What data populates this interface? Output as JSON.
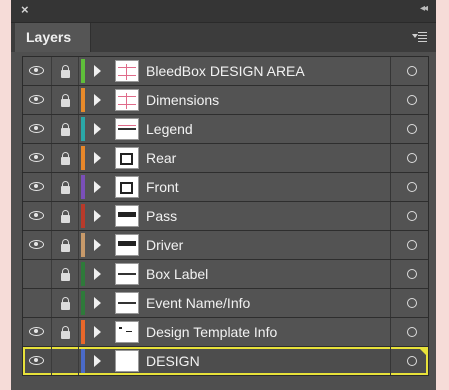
{
  "panel": {
    "close_glyph": "×",
    "collapse_glyph": "◂◂",
    "tab_label": "Layers",
    "menu_icon": "panel-menu-icon"
  },
  "layers": [
    {
      "name": "BleedBox DESIGN AREA",
      "visible": true,
      "locked": true,
      "color": "#5fbf3a",
      "thumb": "guides"
    },
    {
      "name": "Dimensions",
      "visible": true,
      "locked": true,
      "color": "#e88a2a",
      "thumb": "guides"
    },
    {
      "name": "Legend",
      "visible": true,
      "locked": true,
      "color": "#2aa8a8",
      "thumb": "legend"
    },
    {
      "name": "Rear",
      "visible": true,
      "locked": true,
      "color": "#e8872a",
      "thumb": "box"
    },
    {
      "name": "Front",
      "visible": true,
      "locked": true,
      "color": "#7a4fb8",
      "thumb": "box"
    },
    {
      "name": "Pass",
      "visible": true,
      "locked": true,
      "color": "#b83a2a",
      "thumb": "bar"
    },
    {
      "name": "Driver",
      "visible": true,
      "locked": true,
      "color": "#c89a6a",
      "thumb": "bar"
    },
    {
      "name": "Box Label",
      "visible": false,
      "locked": true,
      "color": "#2e7a3a",
      "thumb": "line"
    },
    {
      "name": "Event Name/Info",
      "visible": false,
      "locked": true,
      "color": "#2e7a3a",
      "thumb": "line"
    },
    {
      "name": "Design Template Info",
      "visible": true,
      "locked": true,
      "color": "#e8672a",
      "thumb": "dots"
    },
    {
      "name": "DESIGN",
      "visible": true,
      "locked": false,
      "color": "#4a6ac8",
      "thumb": "blank",
      "selected": true
    }
  ]
}
